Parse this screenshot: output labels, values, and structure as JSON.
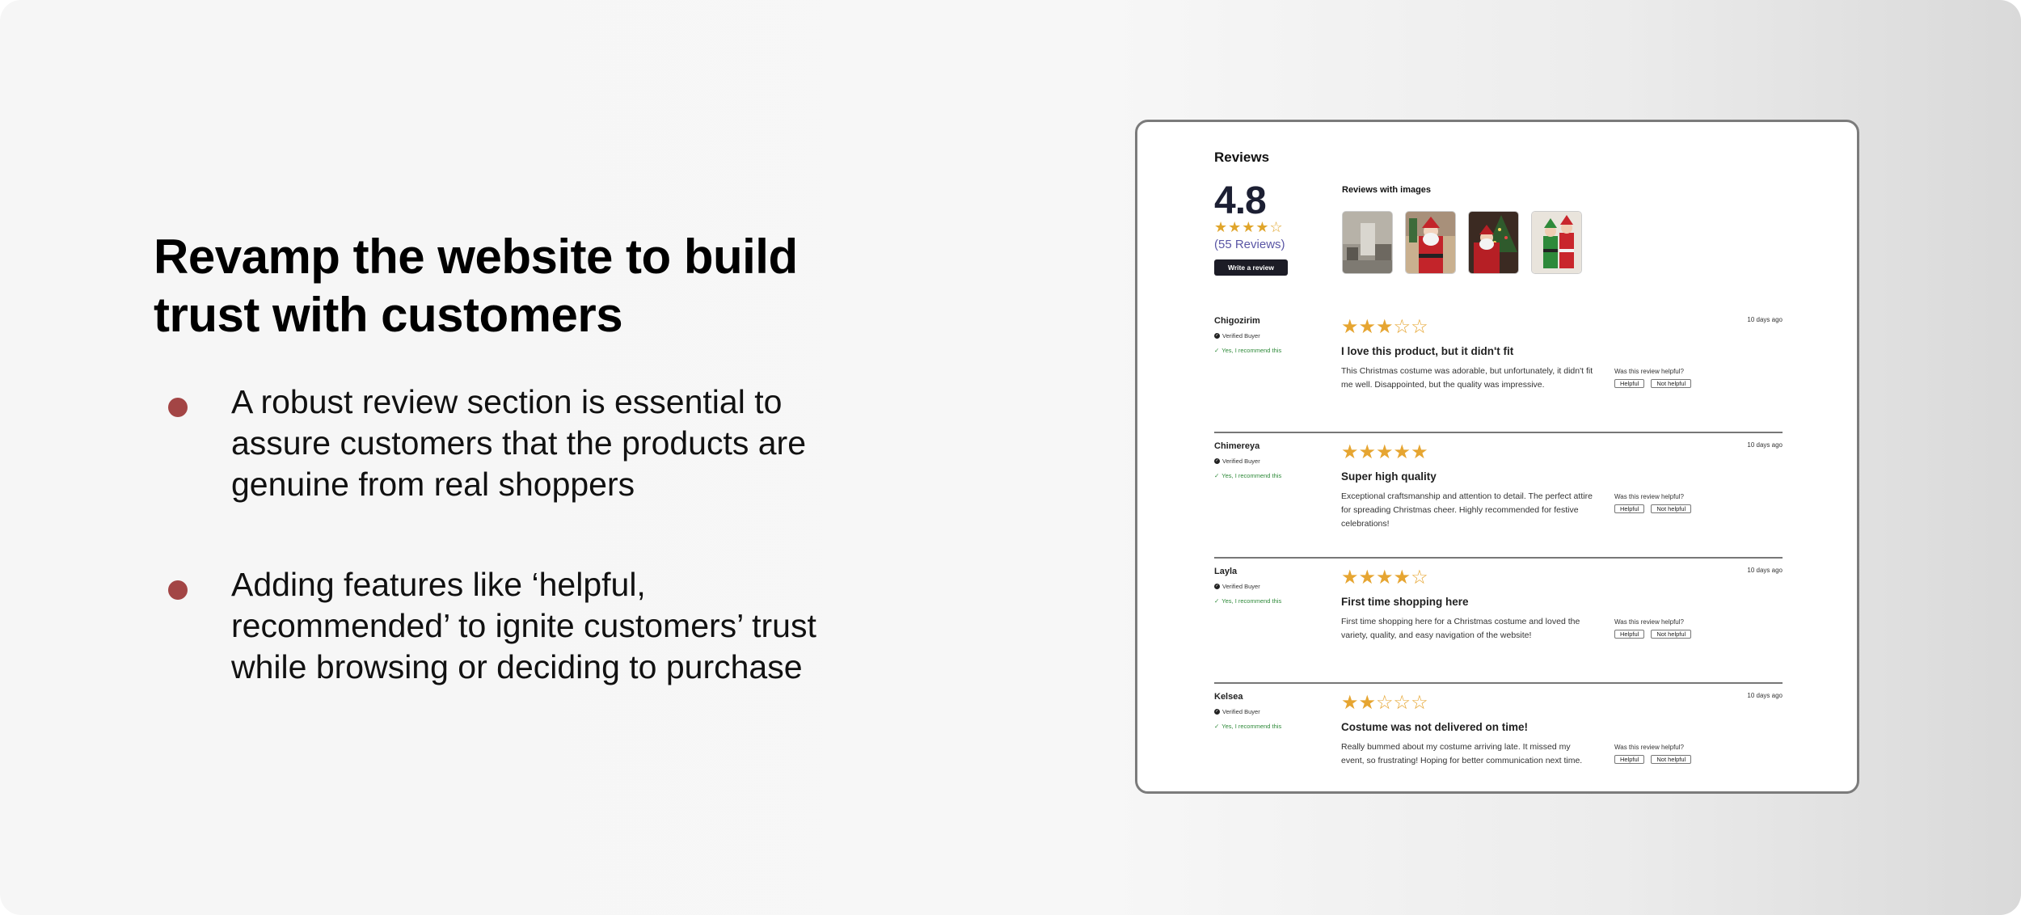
{
  "slide": {
    "headline_line1": "Revamp the website to build",
    "headline_line2": "trust with customers",
    "bullets": [
      {
        "lines": [
          "A robust review section is essential to",
          "assure customers that the products are",
          "genuine from real shoppers"
        ]
      },
      {
        "lines": [
          "Adding features like ‘helpful,",
          "recommended’ to ignite customers’ trust",
          "while browsing or deciding to purchase"
        ]
      }
    ],
    "bullet_color": "#a34545"
  },
  "reviews_panel": {
    "title": "Reviews",
    "average": "4.8",
    "average_stars": "★★★★☆",
    "count_text": "(55 Reviews)",
    "write_button": "Write a review",
    "images_title": "Reviews with images",
    "thumbnails": [
      "hallway-photo",
      "santa-costume-photo",
      "santa-by-tree-photo",
      "elf-costume-photo"
    ],
    "verified_label": "Verified Buyer",
    "recommend_label": "Yes, I recommend this",
    "helpful_question": "Was this review helpful?",
    "helpful_label": "Helpful",
    "not_helpful_label": "Not helpful",
    "star_color": "#e6a531",
    "items": [
      {
        "name": "Chigozirim",
        "rating": 3,
        "date": "10 days ago",
        "title": "I love this product, but it didn't fit",
        "body": "This Christmas costume was adorable, but unfortunately, it didn't fit me well. Disappointed, but the quality was impressive."
      },
      {
        "name": "Chimereya",
        "rating": 5,
        "date": "10 days ago",
        "title": "Super high quality",
        "body": "Exceptional craftsmanship and attention to detail. The perfect attire for spreading Christmas cheer. Highly recommended for festive celebrations!"
      },
      {
        "name": "Layla",
        "rating": 4,
        "date": "10 days ago",
        "title": "First time shopping here",
        "body": "First time shopping here for a Christmas costume and loved the variety, quality, and easy navigation of the website!"
      },
      {
        "name": "Kelsea",
        "rating": 2,
        "date": "10 days ago",
        "title": "Costume was not delivered on time!",
        "body": "Really bummed about my costume arriving late. It missed my event, so frustrating! Hoping for better communication next time."
      }
    ]
  }
}
